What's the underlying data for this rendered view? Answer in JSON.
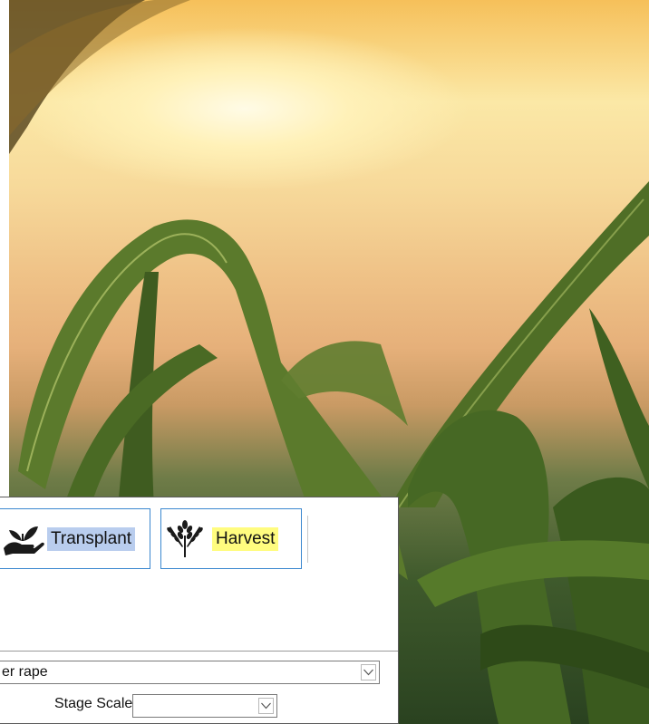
{
  "background": {
    "image": "corn-field-sunset",
    "accent_colors": [
      "#f6c05a",
      "#3f5a2c"
    ]
  },
  "toolbar": {
    "transplant": {
      "label": "Transplant",
      "icon": "transplant-icon",
      "highlight": "#b9cdee"
    },
    "harvest": {
      "label": "Harvest",
      "icon": "wheat-icon",
      "highlight": "#fffc7f"
    }
  },
  "form": {
    "crop_value": "er rape",
    "stage_scale_label": "Stage Scale:",
    "stage_scale_value": ""
  },
  "colors": {
    "button_border": "#3a87cf"
  }
}
